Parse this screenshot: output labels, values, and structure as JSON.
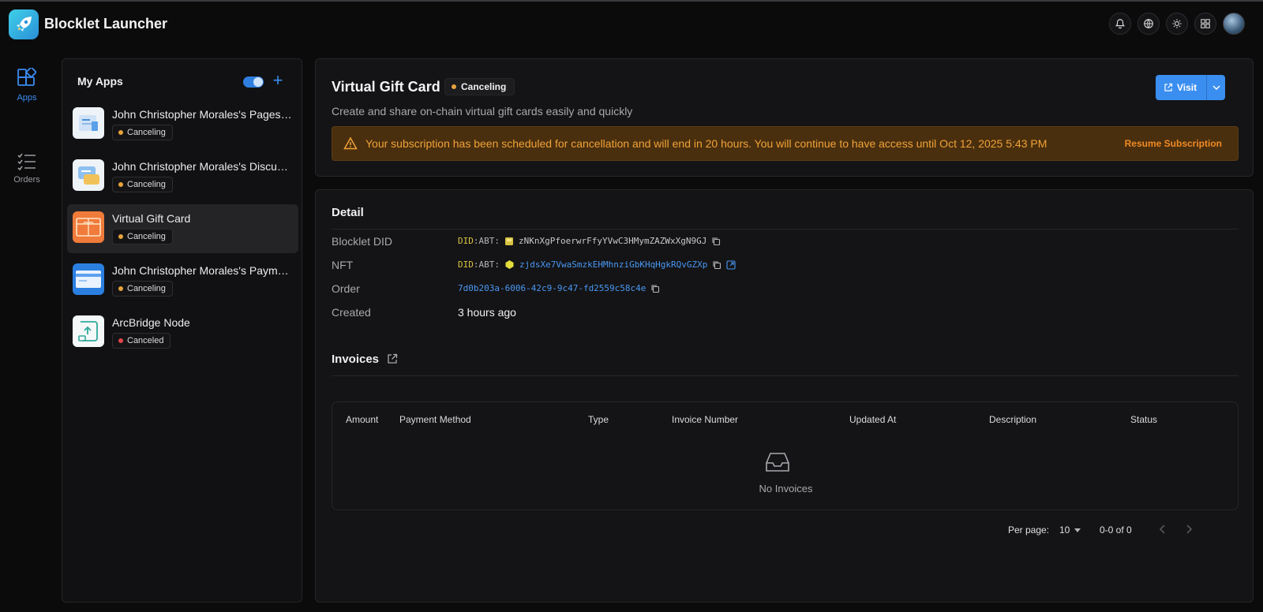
{
  "app": {
    "title": "Blocklet Launcher"
  },
  "nav": {
    "apps_label": "Apps",
    "orders_label": "Orders"
  },
  "sidebar": {
    "title": "My Apps",
    "items": [
      {
        "name": "John Christopher Morales's Pages Kit",
        "status": "Canceling",
        "status_color": "#e8a23c"
      },
      {
        "name": "John Christopher Morales's Discussion Kit",
        "status": "Canceling",
        "status_color": "#e8a23c"
      },
      {
        "name": "Virtual Gift Card",
        "status": "Canceling",
        "status_color": "#e8a23c"
      },
      {
        "name": "John Christopher Morales's Payment Kit",
        "status": "Canceling",
        "status_color": "#e8a23c"
      },
      {
        "name": "ArcBridge Node",
        "status": "Canceled",
        "status_color": "#e0454c"
      }
    ]
  },
  "main": {
    "title": "Virtual Gift Card",
    "status": "Canceling",
    "description": "Create and share on-chain virtual gift cards easily and quickly",
    "visit_label": "Visit",
    "warning": {
      "text": "Your subscription has been scheduled for cancellation and will end in 20 hours. You will continue to have access until Oct 12, 2025 5:43 PM",
      "action": "Resume Subscription"
    }
  },
  "detail": {
    "title": "Detail",
    "blocklet_did_label": "Blocklet DID",
    "blocklet_did_prefix": "DID",
    "blocklet_did_chain": ":ABT:",
    "blocklet_did_value": "zNKnXgPfoerwrFfyYVwC3HMymZAZWxXgN9GJ",
    "nft_label": "NFT",
    "nft_prefix": "DID",
    "nft_chain": ":ABT:",
    "nft_value": "zjdsXe7VwaSmzkEHMhnziGbKHqHgkRQvGZXp",
    "order_label": "Order",
    "order_value": "7d0b203a-6006-42c9-9c47-fd2559c58c4e",
    "created_label": "Created",
    "created_value": "3 hours ago"
  },
  "invoices": {
    "title": "Invoices",
    "columns": [
      "Amount",
      "Payment Method",
      "Type",
      "Invoice Number",
      "Updated At",
      "Description",
      "Status"
    ],
    "empty_text": "No Invoices",
    "per_page_label": "Per page:",
    "per_page_value": "10",
    "range_text": "0-0 of 0"
  },
  "colors": {
    "accent": "#3a8ef0",
    "warning_bg": "#4a2f0e",
    "warning_text": "#f0a238",
    "canceling": "#e8a23c",
    "canceled": "#e0454c"
  },
  "icons": [
    "bell-icon",
    "globe-icon",
    "sun-icon",
    "grid-icon",
    "apps-icon",
    "orders-icon",
    "plus-icon",
    "warning-icon",
    "external-link-icon",
    "copy-icon",
    "chevron-down-icon",
    "inbox-icon",
    "chevron-left-icon",
    "chevron-right-icon"
  ]
}
